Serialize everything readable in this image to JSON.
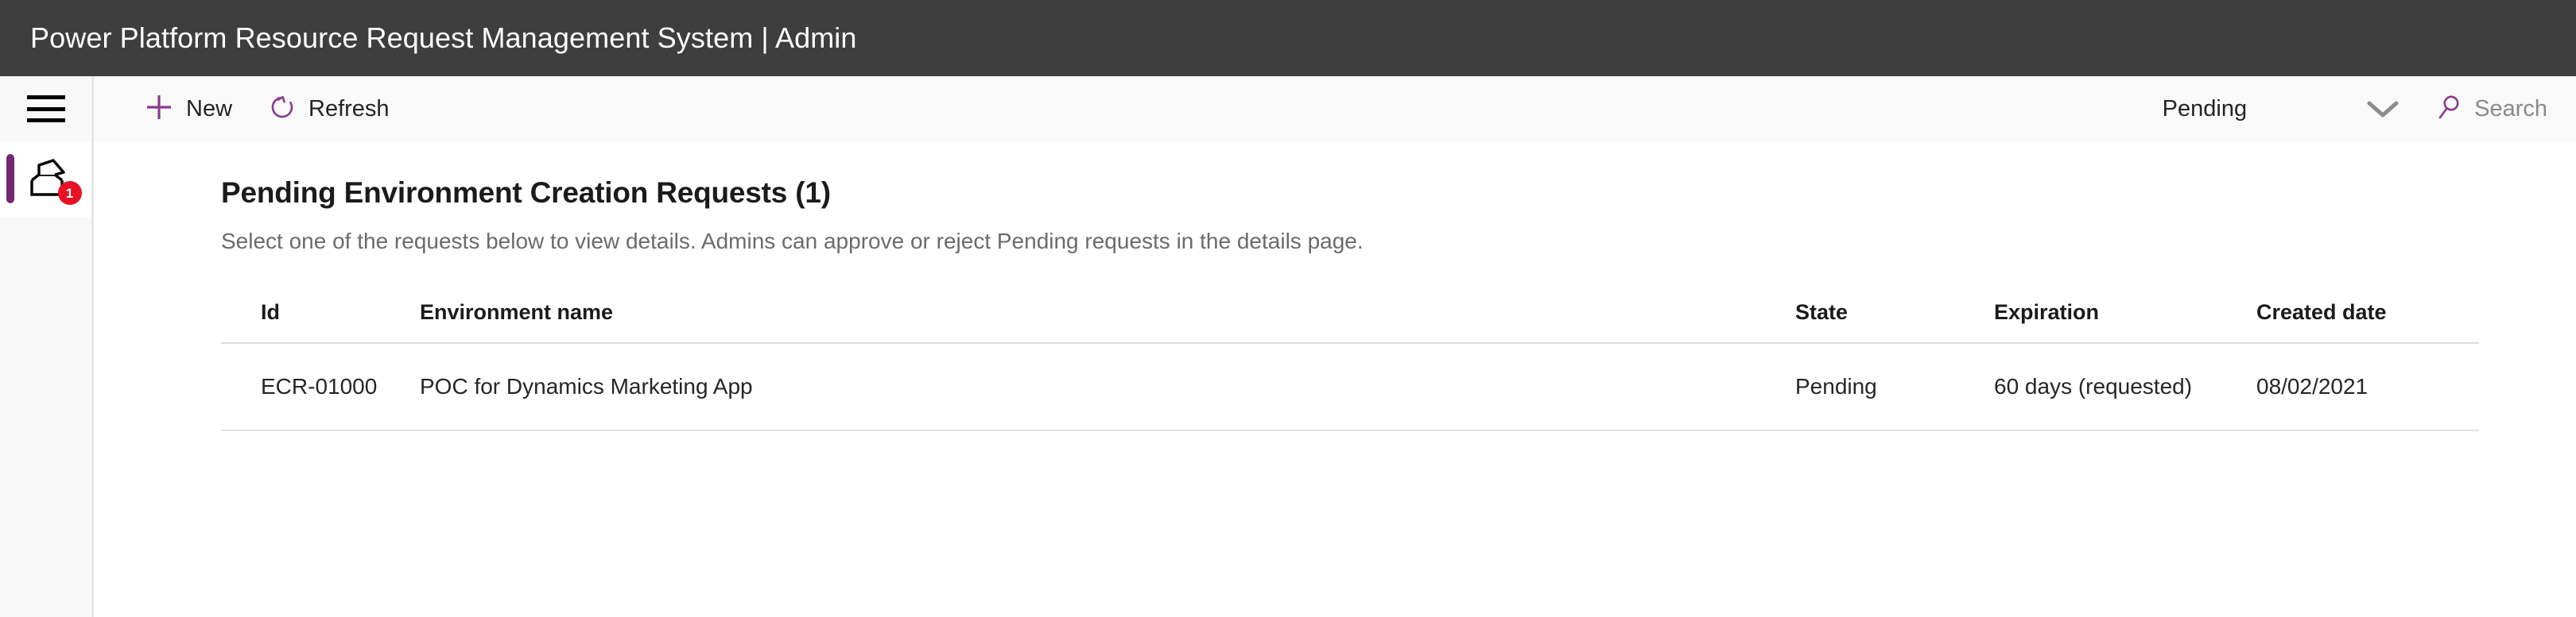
{
  "appbar": {
    "title": "Power Platform Resource Request Management System | Admin"
  },
  "sidebar": {
    "menu_icon": "hamburger-menu-icon",
    "items": [
      {
        "icon": "inbox-tray-icon",
        "badge": "1",
        "selected": true
      }
    ]
  },
  "commandbar": {
    "new_label": "New",
    "new_icon": "plus-icon",
    "refresh_label": "Refresh",
    "refresh_icon": "refresh-circular-arrow-icon",
    "filter_value": "Pending",
    "chevron_icon": "chevron-down-icon",
    "search_icon": "search-icon",
    "search_placeholder": "Search"
  },
  "main": {
    "title": "Pending Environment Creation Requests (1)",
    "subtitle": "Select one of the requests below to view details. Admins can approve or reject Pending requests in the details page.",
    "table": {
      "columns": [
        "Id",
        "Environment name",
        "State",
        "Expiration",
        "Created date"
      ],
      "rows": [
        {
          "id": "ECR-01000",
          "environment_name": "POC for Dynamics Marketing App",
          "state": "Pending",
          "expiration": "60 days (requested)",
          "created_date": "08/02/2021"
        }
      ]
    }
  },
  "colors": {
    "appbar_background": "#3e3e3e",
    "accent_purple": "#742774",
    "badge_red": "#e81123",
    "commandbar_background": "#f9f9f9",
    "sidebar_background": "#f8f8f8"
  }
}
